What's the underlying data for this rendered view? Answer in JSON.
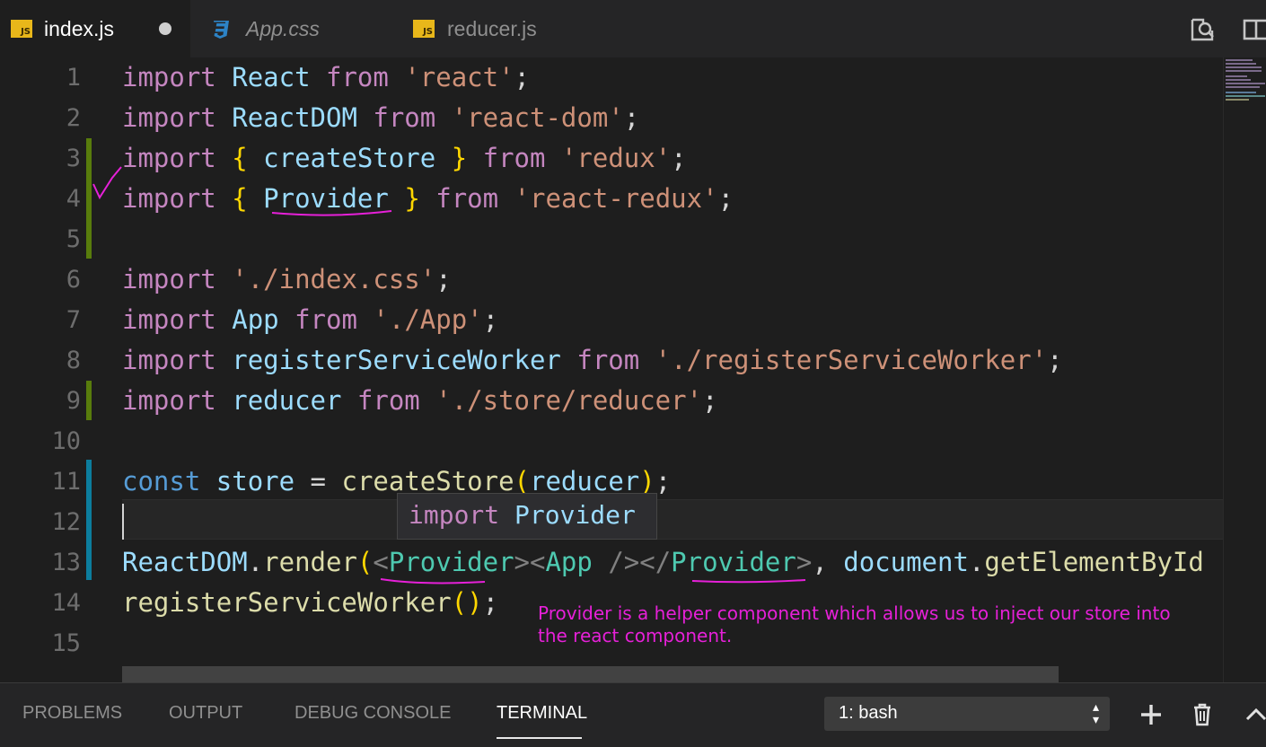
{
  "tabs": [
    {
      "label": "index.js",
      "icon": "js-file-icon",
      "active": true,
      "dirty": true
    },
    {
      "label": "App.css",
      "icon": "css-file-icon",
      "active": false
    },
    {
      "label": "reducer.js",
      "icon": "js-file-icon",
      "active": false
    }
  ],
  "tab_icon_text": "JS",
  "editor": {
    "line_numbers": [
      "1",
      "2",
      "3",
      "4",
      "5",
      "6",
      "7",
      "8",
      "9",
      "10",
      "11",
      "12",
      "13",
      "14",
      "15"
    ],
    "hover_tooltip": {
      "keyword": "import",
      "name": "Provider"
    }
  },
  "annotation_note": "Provider is a helper component which allows us to inject our store into the react component.",
  "panel": {
    "tabs": [
      "PROBLEMS",
      "OUTPUT",
      "DEBUG CONSOLE",
      "TERMINAL"
    ],
    "active_tab": "TERMINAL",
    "terminal_select": "1: bash"
  },
  "colors": {
    "keyword": "#c586c0",
    "string": "#ce9178",
    "variable": "#9cdcfe",
    "function": "#dcdcaa",
    "jsx_tag": "#4ec9b0",
    "annotation_ink": "#e620d8",
    "git_added": "#587c0c",
    "git_modified": "#0c7d9d"
  }
}
